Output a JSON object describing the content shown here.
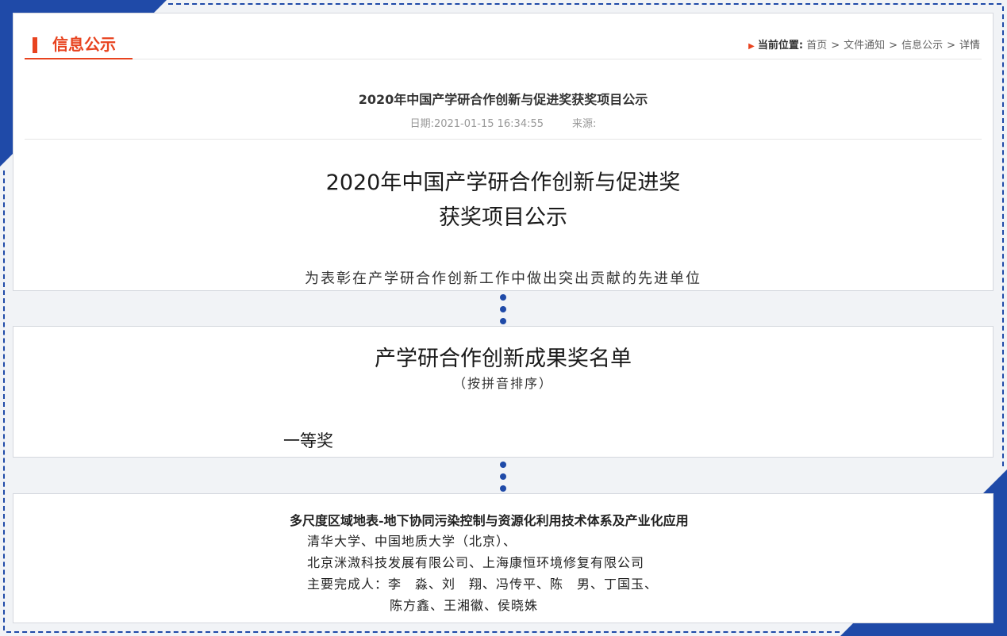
{
  "header": {
    "section_title": "信息公示"
  },
  "breadcrumb": {
    "label": "当前位置:",
    "items": [
      "首页",
      "文件通知",
      "信息公示",
      "详情"
    ],
    "separator": ">"
  },
  "article": {
    "title": "2020年中国产学研合作创新与促进奖获奖项目公示",
    "date_label": "日期:",
    "date_value": "2021-01-15  16:34:55",
    "source_label": "来源:"
  },
  "document": {
    "heading_line1": "2020年中国产学研合作创新与促进奖",
    "heading_line2": "获奖项目公示",
    "intro": "为表彰在产学研合作创新工作中做出突出贡献的先进单位",
    "list_title": "产学研合作创新成果奖名单",
    "list_subtitle": "（按拼音排序）",
    "prize_level": "一等奖",
    "project": {
      "title": "多尺度区域地表-地下协同污染控制与资源化利用技术体系及产业化应用",
      "line1": "清华大学、中国地质大学（北京）、",
      "line2": "北京洣溦科技发展有限公司、上海康恒环境修复有限公司",
      "line3": "主要完成人：李　淼、刘　翔、冯传平、陈　男、丁国玉、",
      "line4": "陈方鑫、王湘徽、侯晓姝"
    }
  },
  "colors": {
    "accent": "#e8431f",
    "frame": "#1f4aa8"
  }
}
